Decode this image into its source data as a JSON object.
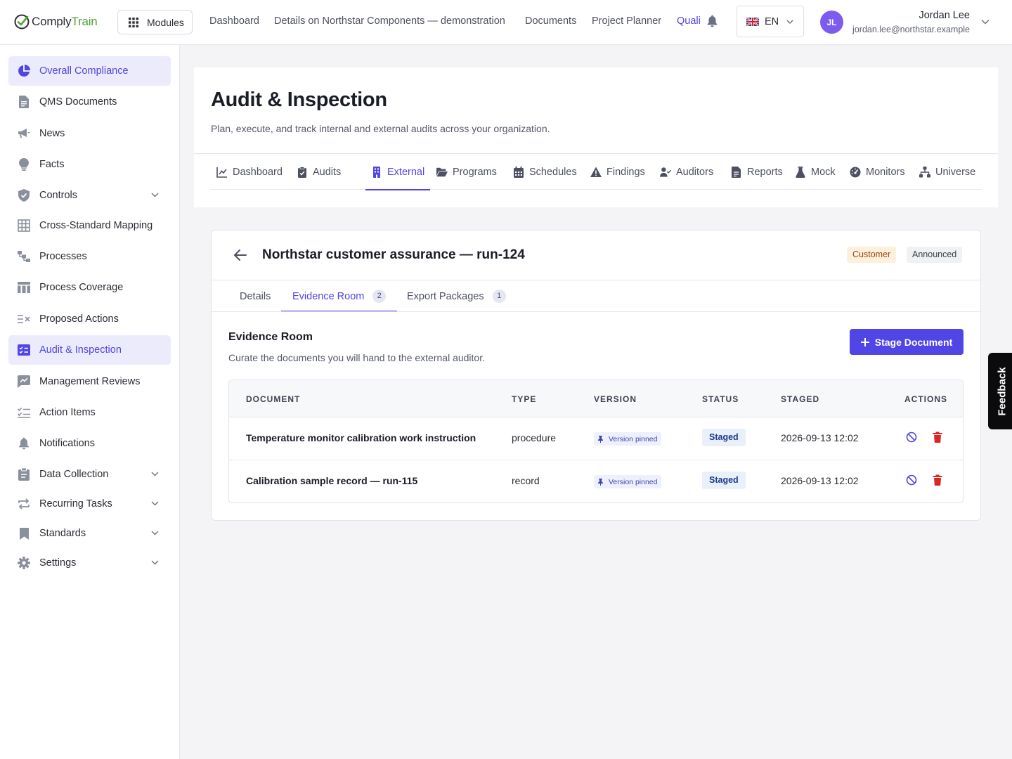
{
  "brand": {
    "name_part1": "Comply",
    "name_part2": "Train",
    "accent": "#52a436"
  },
  "topbar": {
    "modules_label": "Modules",
    "nav": [
      "Dashboard",
      "Details on Northstar Components — demonstration",
      "Documents",
      "Project Planner",
      "Quali"
    ],
    "active_nav": "Quali",
    "language": "EN",
    "user": {
      "initials": "JL",
      "name": "Jordan Lee",
      "email": "jordan.lee@northstar.example"
    }
  },
  "sidebar": {
    "items": [
      {
        "label": "Overall Compliance",
        "icon": "pie-chart-icon",
        "highlighted": true
      },
      {
        "label": "QMS Documents",
        "icon": "document-icon"
      },
      {
        "label": "News",
        "icon": "megaphone-icon"
      },
      {
        "label": "Facts",
        "icon": "lightbulb-icon"
      },
      {
        "label": "Controls",
        "icon": "shield-check-icon",
        "expandable": true
      },
      {
        "label": "Cross-Standard Mapping",
        "icon": "table-grid-icon"
      },
      {
        "label": "Processes",
        "icon": "process-flow-icon"
      },
      {
        "label": "Process Coverage",
        "icon": "columns-icon"
      },
      {
        "label": "Proposed Actions",
        "icon": "list-x-icon"
      },
      {
        "label": "Audit & Inspection",
        "icon": "checklist-box-icon",
        "active": true
      },
      {
        "label": "Management Reviews",
        "icon": "chart-comment-icon"
      },
      {
        "label": "Action Items",
        "icon": "checklist-icon"
      },
      {
        "label": "Notifications",
        "icon": "bell-icon"
      },
      {
        "label": "Data Collection",
        "icon": "clipboard-icon",
        "expandable": true
      },
      {
        "label": "Recurring Tasks",
        "icon": "repeat-icon",
        "expandable": true
      },
      {
        "label": "Standards",
        "icon": "bookmark-icon",
        "expandable": true
      },
      {
        "label": "Settings",
        "icon": "gear-icon",
        "expandable": true
      }
    ]
  },
  "page": {
    "title": "Audit & Inspection",
    "subtitle": "Plan, execute, and track internal and external audits across your organization.",
    "tabs": [
      {
        "label": "Dashboard",
        "icon": "line-chart-icon"
      },
      {
        "label": "Audits",
        "icon": "clipboard-check-icon"
      },
      {
        "label": "External",
        "icon": "building-icon",
        "active": true
      },
      {
        "label": "Programs",
        "icon": "folder-open-icon"
      },
      {
        "label": "Schedules",
        "icon": "calendar-icon"
      },
      {
        "label": "Findings",
        "icon": "warning-triangle-icon"
      },
      {
        "label": "Auditors",
        "icon": "user-check-icon"
      },
      {
        "label": "Reports",
        "icon": "report-file-icon"
      },
      {
        "label": "Mock",
        "icon": "flask-icon"
      },
      {
        "label": "Monitors",
        "icon": "gauge-icon"
      },
      {
        "label": "Universe",
        "icon": "hierarchy-icon"
      }
    ]
  },
  "audit": {
    "title": "Northstar customer assurance — run-124",
    "badges": {
      "type": "Customer",
      "state": "Announced"
    },
    "tabs": [
      {
        "label": "Details"
      },
      {
        "label": "Evidence Room",
        "count": "2",
        "active": true
      },
      {
        "label": "Export Packages",
        "count": "1"
      }
    ],
    "evidence": {
      "title": "Evidence Room",
      "subtitle": "Curate the documents you will hand to the external auditor.",
      "stage_button": "Stage Document",
      "columns": [
        "DOCUMENT",
        "TYPE",
        "VERSION",
        "STATUS",
        "STAGED",
        "ACTIONS"
      ],
      "rows": [
        {
          "document": "Temperature monitor calibration work instruction",
          "type": "procedure",
          "version": "Version pinned",
          "status": "Staged",
          "staged": "2026-09-13 12:02"
        },
        {
          "document": "Calibration sample record — run-115",
          "type": "record",
          "version": "Version pinned",
          "status": "Staged",
          "staged": "2026-09-13 12:02"
        }
      ]
    }
  },
  "feedback_label": "Feedback",
  "colors": {
    "primary": "#4f46e5",
    "danger": "#dc2626",
    "customer_badge_bg": "#fdf0dd",
    "staged_badge_bg": "#e9f0fb"
  }
}
